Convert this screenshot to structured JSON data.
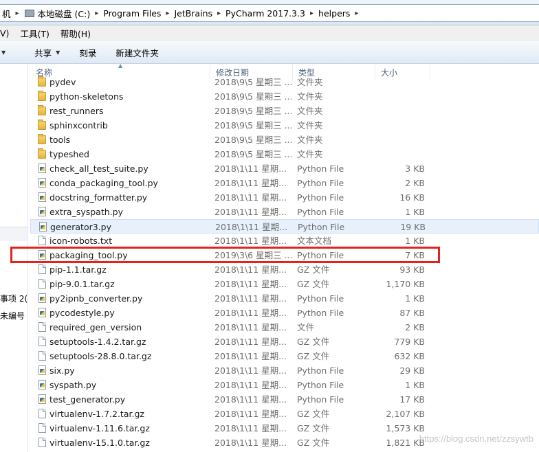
{
  "address_bar": {
    "crumbs": [
      "机",
      "本地磁盘 (C:)",
      "Program Files",
      "JetBrains",
      "PyCharm 2017.3.3",
      "helpers"
    ]
  },
  "menu": {
    "items": [
      "V)",
      "工具(T)",
      "帮助(H)"
    ]
  },
  "toolbar": {
    "share_label": "共享",
    "burn_label": "刻录",
    "new_folder_label": "新建文件夹"
  },
  "nav_fragments": [
    "事项 2(",
    "未编号"
  ],
  "columns": {
    "name": "名称",
    "date": "修改日期",
    "type": "类型",
    "size": "大小"
  },
  "files": [
    {
      "name": "pydev",
      "date": "2018\\9\\5 星期三 ...",
      "type": "文件夹",
      "size": "",
      "icon": "folder-icon"
    },
    {
      "name": "python-skeletons",
      "date": "2018\\9\\5 星期三 ...",
      "type": "文件夹",
      "size": "",
      "icon": "folder-icon"
    },
    {
      "name": "rest_runners",
      "date": "2018\\9\\5 星期三 ...",
      "type": "文件夹",
      "size": "",
      "icon": "folder-icon"
    },
    {
      "name": "sphinxcontrib",
      "date": "2018\\9\\5 星期三 ...",
      "type": "文件夹",
      "size": "",
      "icon": "folder-icon"
    },
    {
      "name": "tools",
      "date": "2018\\9\\5 星期三 ...",
      "type": "文件夹",
      "size": "",
      "icon": "folder-icon"
    },
    {
      "name": "typeshed",
      "date": "2018\\9\\5 星期三 ...",
      "type": "文件夹",
      "size": "",
      "icon": "folder-icon"
    },
    {
      "name": "check_all_test_suite.py",
      "date": "2018\\1\\11 星期...",
      "type": "Python File",
      "size": "3 KB",
      "icon": "python-file-icon"
    },
    {
      "name": "conda_packaging_tool.py",
      "date": "2018\\1\\11 星期...",
      "type": "Python File",
      "size": "2 KB",
      "icon": "python-file-icon"
    },
    {
      "name": "docstring_formatter.py",
      "date": "2018\\1\\11 星期...",
      "type": "Python File",
      "size": "16 KB",
      "icon": "python-file-icon"
    },
    {
      "name": "extra_syspath.py",
      "date": "2018\\1\\11 星期...",
      "type": "Python File",
      "size": "1 KB",
      "icon": "python-file-icon"
    },
    {
      "name": "generator3.py",
      "date": "2018\\1\\11 星期...",
      "type": "Python File",
      "size": "19 KB",
      "icon": "python-file-icon"
    },
    {
      "name": "icon-robots.txt",
      "date": "2018\\1\\11 星期...",
      "type": "文本文档",
      "size": "1 KB",
      "icon": "text-file-icon"
    },
    {
      "name": "packaging_tool.py",
      "date": "2019\\3\\6 星期三 ...",
      "type": "Python File",
      "size": "7 KB",
      "icon": "python-file-icon"
    },
    {
      "name": "pip-1.1.tar.gz",
      "date": "2018\\1\\11 星期...",
      "type": "GZ 文件",
      "size": "93 KB",
      "icon": "file-icon"
    },
    {
      "name": "pip-9.0.1.tar.gz",
      "date": "2018\\1\\11 星期...",
      "type": "GZ 文件",
      "size": "1,170 KB",
      "icon": "file-icon"
    },
    {
      "name": "py2ipnb_converter.py",
      "date": "2018\\1\\11 星期...",
      "type": "Python File",
      "size": "1 KB",
      "icon": "python-file-icon"
    },
    {
      "name": "pycodestyle.py",
      "date": "2018\\1\\11 星期...",
      "type": "Python File",
      "size": "87 KB",
      "icon": "python-file-icon"
    },
    {
      "name": "required_gen_version",
      "date": "2018\\1\\11 星期...",
      "type": "文件",
      "size": "2 KB",
      "icon": "file-icon"
    },
    {
      "name": "setuptools-1.4.2.tar.gz",
      "date": "2018\\1\\11 星期...",
      "type": "GZ 文件",
      "size": "779 KB",
      "icon": "file-icon"
    },
    {
      "name": "setuptools-28.8.0.tar.gz",
      "date": "2018\\1\\11 星期...",
      "type": "GZ 文件",
      "size": "632 KB",
      "icon": "file-icon"
    },
    {
      "name": "six.py",
      "date": "2018\\1\\11 星期...",
      "type": "Python File",
      "size": "29 KB",
      "icon": "python-file-icon"
    },
    {
      "name": "syspath.py",
      "date": "2018\\1\\11 星期...",
      "type": "Python File",
      "size": "1 KB",
      "icon": "python-file-icon"
    },
    {
      "name": "test_generator.py",
      "date": "2018\\1\\11 星期...",
      "type": "Python File",
      "size": "17 KB",
      "icon": "python-file-icon"
    },
    {
      "name": "virtualenv-1.7.2.tar.gz",
      "date": "2018\\1\\11 星期...",
      "type": "GZ 文件",
      "size": "2,107 KB",
      "icon": "file-icon"
    },
    {
      "name": "virtualenv-1.11.6.tar.gz",
      "date": "2018\\1\\11 星期...",
      "type": "GZ 文件",
      "size": "1,573 KB",
      "icon": "file-icon"
    },
    {
      "name": "virtualenv-15.1.0.tar.gz",
      "date": "2018\\1\\11 星期...",
      "type": "GZ 文件",
      "size": "1,821 KB",
      "icon": "file-icon"
    }
  ],
  "selected_file": "generator3.py",
  "highlighted_file": "packaging_tool.py",
  "highlight_color": "#e8211d",
  "watermark": "https://blog.csdn.net/zzsywtb"
}
